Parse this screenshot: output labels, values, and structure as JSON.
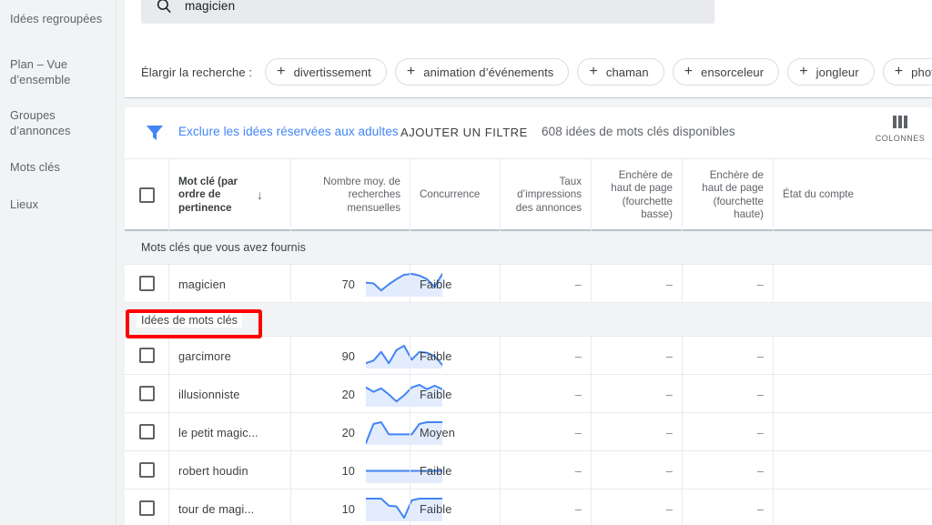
{
  "sidebar": {
    "items": [
      {
        "label": "Idées regroupées",
        "name": "sidebar-item-idees-regroupees"
      },
      {
        "label": "Plan – Vue d’ensemble",
        "name": "sidebar-item-plan-vue-ensemble"
      },
      {
        "label": "Groupes d’annonces",
        "name": "sidebar-item-groupes-annonces"
      },
      {
        "label": "Mots clés",
        "name": "sidebar-item-mots-cles"
      },
      {
        "label": "Lieux",
        "name": "sidebar-item-lieux"
      }
    ]
  },
  "search": {
    "icon": "search-icon",
    "value": "magicien",
    "placeholder": "magicien"
  },
  "expand": {
    "label": "Élargir la recherche :",
    "chips": [
      "divertissement",
      "animation d’événements",
      "chaman",
      "ensorceleur",
      "jongleur",
      "photograph"
    ]
  },
  "toolbar": {
    "filter_icon": "filter-icon",
    "exclude_link": "Exclure les idées réservées aux adultes",
    "add_filter": "AJOUTER UN FILTRE",
    "available_count": "608 idées de mots clés disponibles",
    "columns_label": "COLONNES",
    "columns_icon": "columns-icon"
  },
  "table": {
    "headers": {
      "keyword": "Mot clé (par ordre de pertinence",
      "sort_arrow": "↓",
      "volume": "Nombre moy. de recherches mensuelles",
      "competition": "Concurrence",
      "impression_share": "Taux d’impressions des annonces",
      "bid_low": "Enchère de haut de page (fourchette basse)",
      "bid_high": "Enchère de haut de page (fourchette haute)",
      "account_state": "État du compte"
    },
    "groups": [
      {
        "label": "Mots clés que vous avez fournis",
        "highlighted": false
      },
      {
        "label": "Idées de mots clés",
        "highlighted": true
      }
    ],
    "rows_provided": [
      {
        "keyword": "magicien",
        "volume": "70",
        "competition": "Faible",
        "impression_share": "–",
        "bid_low": "–",
        "bid_high": "–",
        "account_state": "",
        "spark": [
          14,
          13,
          5,
          12,
          18,
          23,
          24,
          22,
          18,
          9,
          24
        ]
      }
    ],
    "rows_ideas": [
      {
        "keyword": "garcimore",
        "volume": "90",
        "competition": "Faible",
        "impression_share": "–",
        "bid_low": "–",
        "bid_high": "–",
        "account_state": "",
        "spark": [
          4,
          7,
          17,
          4,
          19,
          24,
          8,
          17,
          16,
          12,
          2
        ]
      },
      {
        "keyword": "illusionniste",
        "volume": "20",
        "competition": "Faible",
        "impression_share": "–",
        "bid_low": "–",
        "bid_high": "–",
        "account_state": "",
        "spark": [
          20,
          15,
          19,
          12,
          4,
          11,
          20,
          23,
          18,
          22,
          18
        ]
      },
      {
        "keyword": "le petit magic...",
        "volume": "20",
        "competition": "Moyen",
        "impression_share": "–",
        "bid_low": "–",
        "bid_high": "–",
        "account_state": "",
        "spark": [
          0,
          22,
          24,
          10,
          10,
          10,
          10,
          22,
          24,
          24,
          24
        ]
      },
      {
        "keyword": "robert houdin",
        "volume": "10",
        "competition": "Faible",
        "impression_share": "–",
        "bid_low": "–",
        "bid_high": "–",
        "account_state": "",
        "spark": [
          12,
          12,
          12,
          12,
          12,
          12,
          12,
          12,
          12,
          12,
          12
        ]
      },
      {
        "keyword": "tour de magi...",
        "volume": "10",
        "competition": "Faible",
        "impression_share": "–",
        "bid_low": "–",
        "bid_high": "–",
        "account_state": "",
        "spark": [
          24,
          24,
          24,
          16,
          15,
          2,
          22,
          24,
          24,
          24,
          24
        ]
      }
    ]
  },
  "annotation": {
    "color": "#ff0000",
    "target": "Idées de mots clés"
  },
  "colors": {
    "accent_blue": "#4285f4",
    "sidebar_bg": "#f1f3f4",
    "text_primary": "#3c4043",
    "text_secondary": "#5f6368"
  }
}
